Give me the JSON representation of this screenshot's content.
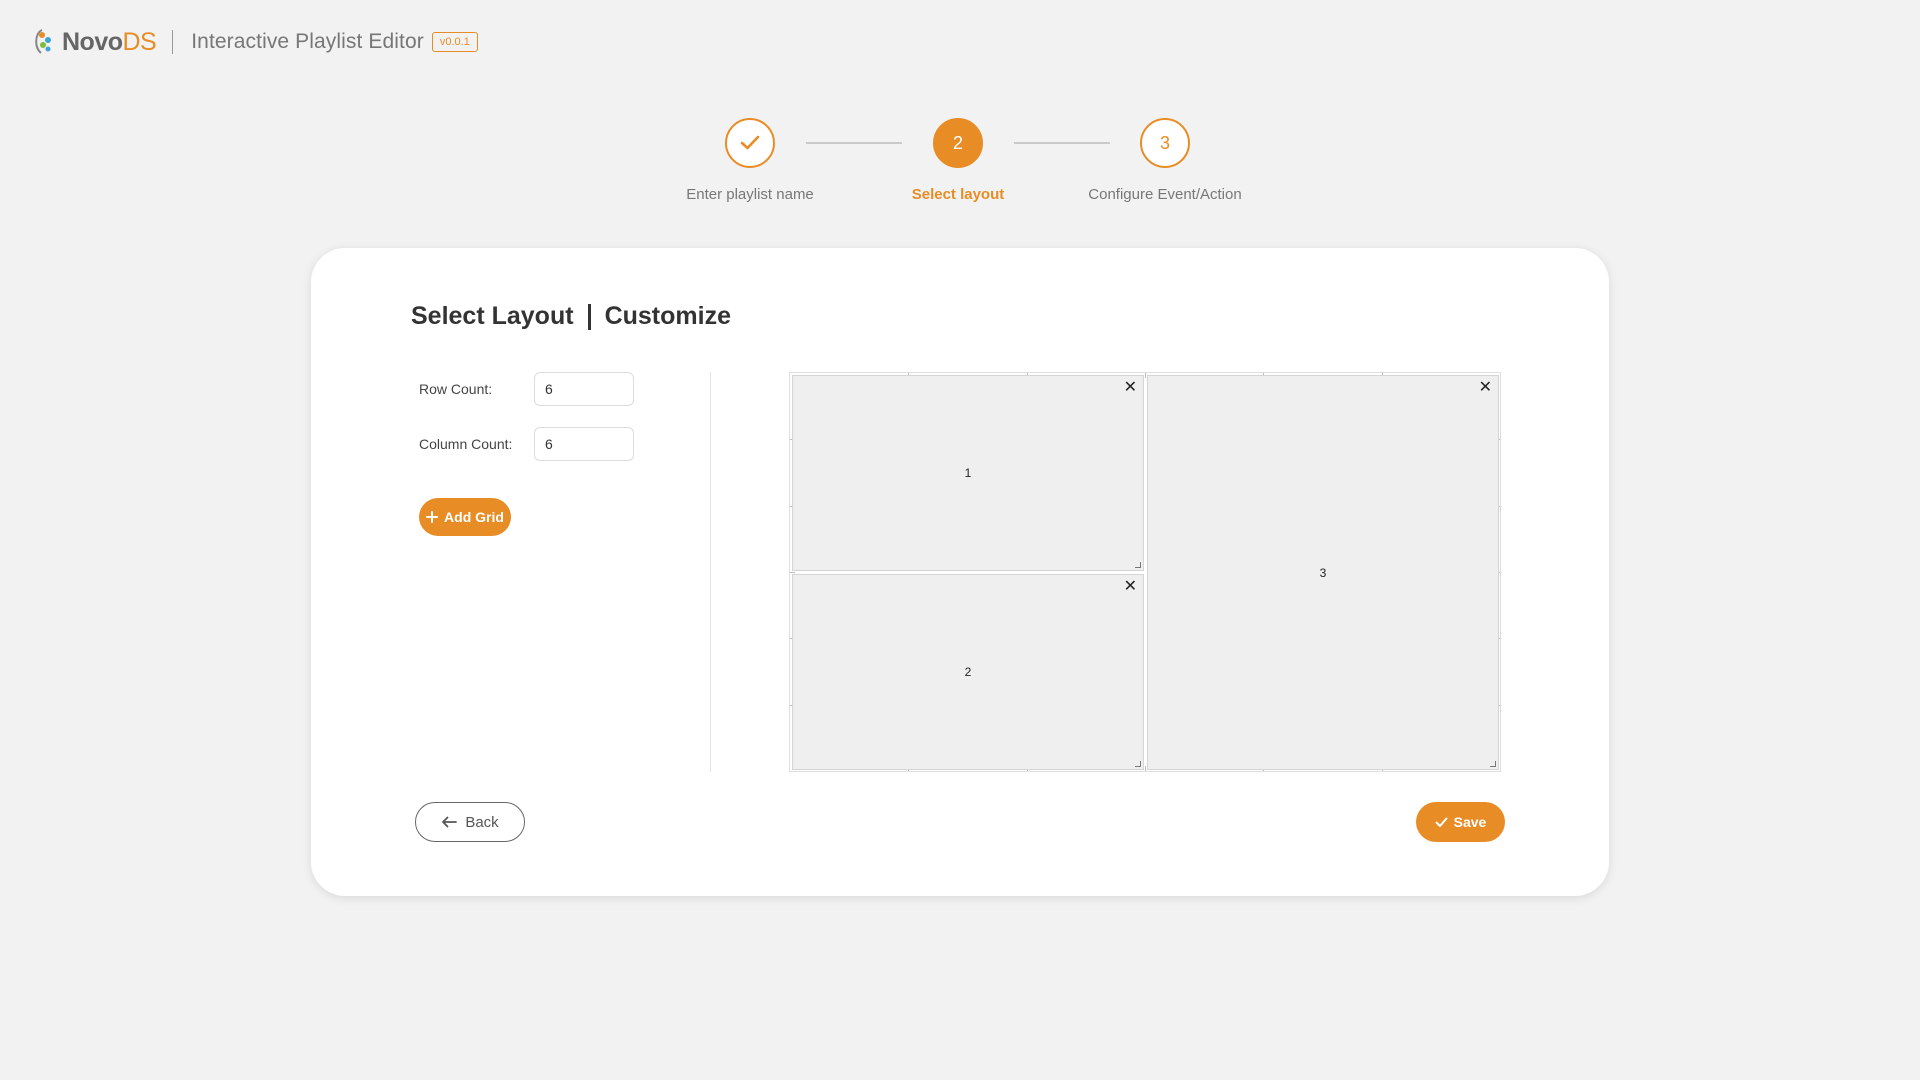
{
  "header": {
    "logo_novo": "Novo",
    "logo_ds": "DS",
    "app_title": "Interactive Playlist Editor",
    "version": "v0.0.1",
    "accent_color": "#e88c25"
  },
  "stepper": {
    "steps": [
      {
        "label": "Enter playlist name",
        "number": "",
        "state": "completed",
        "icon": "check-icon"
      },
      {
        "label": "Select layout",
        "number": "2",
        "state": "active"
      },
      {
        "label": "Configure Event/Action",
        "number": "3",
        "state": "pending"
      }
    ]
  },
  "card": {
    "title": "Select Layout",
    "subtitle": "Customize",
    "row_count_label": "Row Count:",
    "row_count_value": "6",
    "column_count_label": "Column Count:",
    "column_count_value": "6",
    "add_grid_label": "Add Grid",
    "add_grid_icon": "plus-icon"
  },
  "grid": {
    "rows": 6,
    "columns": 6,
    "cells": [
      {
        "label": "1",
        "row": 1,
        "col": 1,
        "row_span": 3,
        "col_span": 3
      },
      {
        "label": "2",
        "row": 4,
        "col": 1,
        "row_span": 3,
        "col_span": 3
      },
      {
        "label": "3",
        "row": 1,
        "col": 4,
        "row_span": 6,
        "col_span": 3
      }
    ],
    "close_icon": "close-icon"
  },
  "footer": {
    "back_label": "Back",
    "back_icon": "arrow-left-icon",
    "save_label": "Save",
    "save_icon": "check-icon"
  }
}
